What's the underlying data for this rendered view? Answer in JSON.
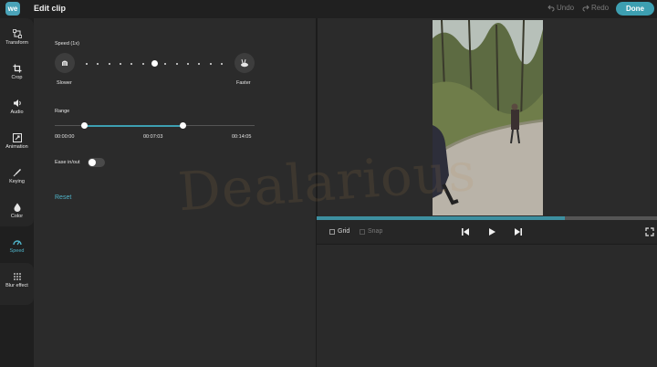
{
  "app": {
    "logo_text": "we",
    "title": "Edit clip",
    "accent": "#3d9fb1"
  },
  "toolbar": {
    "undo_label": "Undo",
    "redo_label": "Redo",
    "done_label": "Done"
  },
  "sidebar": {
    "items": [
      {
        "label": "Transform",
        "icon": "transform-icon"
      },
      {
        "label": "Crop",
        "icon": "crop-icon"
      },
      {
        "label": "Audio",
        "icon": "audio-icon"
      },
      {
        "label": "Animation",
        "icon": "animation-icon"
      },
      {
        "label": "Keying",
        "icon": "keying-icon"
      },
      {
        "label": "Color",
        "icon": "color-icon"
      },
      {
        "label": "Speed",
        "icon": "speed-icon",
        "active": true
      },
      {
        "label": "Blur effect",
        "icon": "blur-icon"
      }
    ]
  },
  "speed": {
    "heading": "Speed (1x)",
    "slower_label": "Slower",
    "faster_label": "Faster",
    "current_step": 6,
    "step_count": 13
  },
  "range": {
    "heading": "Range",
    "start_time": "00:00:00",
    "mid_time": "00:07:03",
    "end_time": "00:14:05",
    "selected_start": 0.15,
    "selected_end": 0.64
  },
  "ease": {
    "label": "Ease in/out",
    "enabled": false
  },
  "reset_label": "Reset",
  "preview": {
    "grid_label": "Grid",
    "snap_label": "Snap",
    "grid_checked": false,
    "snap_checked": false,
    "playback_progress": 0.73,
    "watermark": "Dealarious"
  }
}
